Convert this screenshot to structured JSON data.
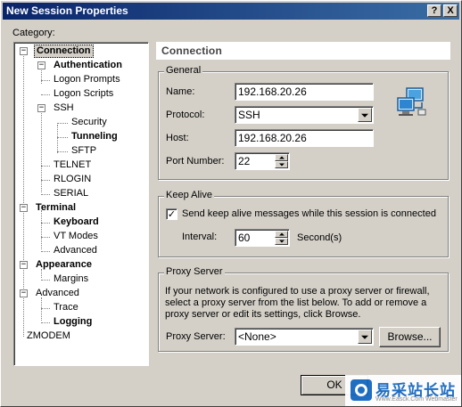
{
  "window": {
    "title": "New Session Properties",
    "help_glyph": "?",
    "close_glyph": "X"
  },
  "category_label": "Category:",
  "tree": [
    {
      "label": "Connection",
      "expander": "−",
      "bold": true,
      "selected": true
    },
    {
      "label": "Authentication",
      "expander": "−",
      "bold": true
    },
    {
      "label": "Logon Prompts"
    },
    {
      "label": "Logon Scripts"
    },
    {
      "label": "SSH",
      "expander": "−"
    },
    {
      "label": "Security"
    },
    {
      "label": "Tunneling",
      "bold": true
    },
    {
      "label": "SFTP"
    },
    {
      "label": "TELNET"
    },
    {
      "label": "RLOGIN"
    },
    {
      "label": "SERIAL"
    },
    {
      "label": "Terminal",
      "expander": "−",
      "bold": true
    },
    {
      "label": "Keyboard",
      "bold": true
    },
    {
      "label": "VT Modes"
    },
    {
      "label": "Advanced"
    },
    {
      "label": "Appearance",
      "expander": "−",
      "bold": true
    },
    {
      "label": "Margins"
    },
    {
      "label": "Advanced",
      "expander": "−"
    },
    {
      "label": "Trace"
    },
    {
      "label": "Logging",
      "bold": true
    },
    {
      "label": "ZMODEM"
    }
  ],
  "panel_title": "Connection",
  "general": {
    "group_label": "General",
    "name_label": "Name:",
    "name_value": "192.168.20.26",
    "protocol_label": "Protocol:",
    "protocol_value": "SSH",
    "host_label": "Host:",
    "host_value": "192.168.20.26",
    "port_label": "Port Number:",
    "port_value": "22",
    "network_icon": "network-computers-icon"
  },
  "keep_alive": {
    "group_label": "Keep Alive",
    "checkbox_label": "Send keep alive messages while this session is connected",
    "checked": true,
    "check_glyph": "✓",
    "interval_label": "Interval:",
    "interval_value": "60",
    "interval_unit": "Second(s)"
  },
  "proxy": {
    "group_label": "Proxy Server",
    "description": "If your network is configured to use a proxy server or firewall, select a proxy server from the list below. To add or remove a proxy server or edit its settings, click Browse.",
    "label": "Proxy Server:",
    "value": "<None>",
    "browse_label": "Browse..."
  },
  "buttons": {
    "ok_label": "OK"
  },
  "watermark": {
    "brand_text": "易采站长站",
    "sub_text": "Www.Easck.Com  Webmaster"
  }
}
